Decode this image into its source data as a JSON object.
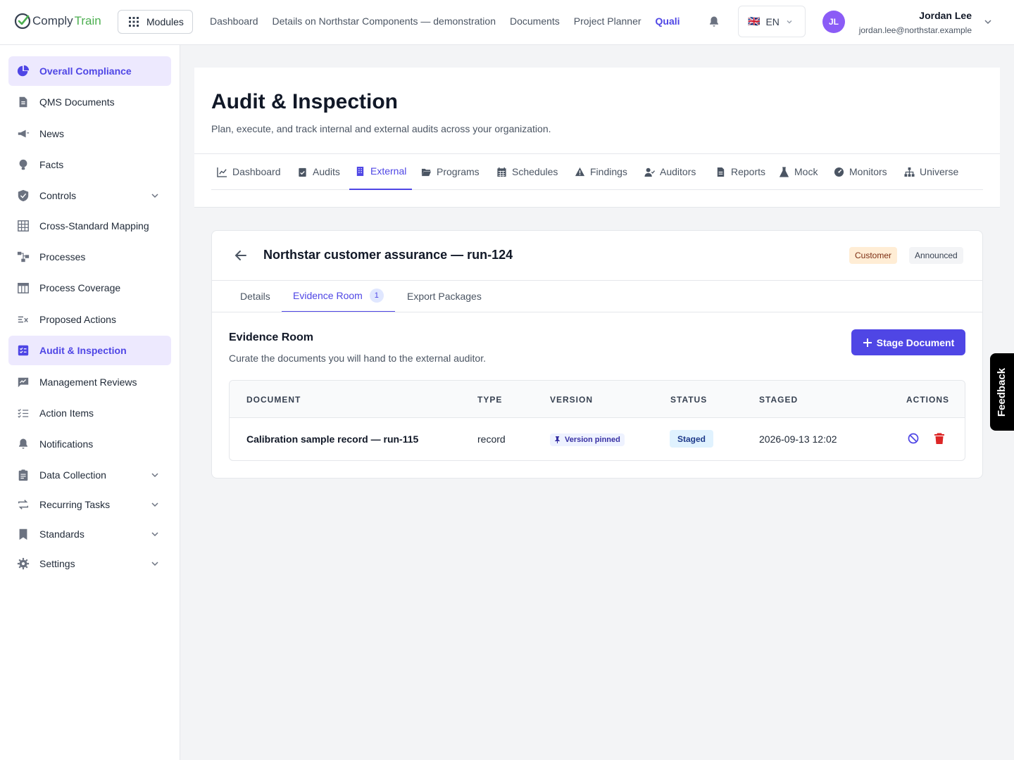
{
  "app": {
    "logo_part1": "Comply",
    "logo_part2": "Train",
    "modules_label": "Modules"
  },
  "topnav": [
    "Dashboard",
    "Details on Northstar Components — demonstration",
    "Documents",
    "Project Planner",
    "Quali"
  ],
  "lang": {
    "flag": "🇬🇧",
    "code": "EN"
  },
  "user": {
    "initials": "JL",
    "name": "Jordan Lee",
    "email": "jordan.lee@northstar.example"
  },
  "sidebar": {
    "items": [
      {
        "label": "Overall Compliance",
        "icon": "pie-chart-icon"
      },
      {
        "label": "QMS Documents",
        "icon": "document-icon"
      },
      {
        "label": "News",
        "icon": "megaphone-icon"
      },
      {
        "label": "Facts",
        "icon": "lightbulb-icon"
      },
      {
        "label": "Controls",
        "icon": "shield-icon"
      },
      {
        "label": "Cross-Standard Mapping",
        "icon": "grid-icon"
      },
      {
        "label": "Processes",
        "icon": "flow-icon"
      },
      {
        "label": "Process Coverage",
        "icon": "table-icon"
      },
      {
        "label": "Proposed Actions",
        "icon": "list-x-icon"
      },
      {
        "label": "Audit & Inspection",
        "icon": "checklist-icon"
      },
      {
        "label": "Management Reviews",
        "icon": "chart-review-icon"
      },
      {
        "label": "Action Items",
        "icon": "list-check-icon"
      },
      {
        "label": "Notifications",
        "icon": "bell-icon"
      },
      {
        "label": "Data Collection",
        "icon": "clipboard-icon"
      },
      {
        "label": "Recurring Tasks",
        "icon": "repeat-icon"
      },
      {
        "label": "Standards",
        "icon": "bookmark-icon"
      },
      {
        "label": "Settings",
        "icon": "gear-icon"
      }
    ]
  },
  "page": {
    "title": "Audit & Inspection",
    "subtitle": "Plan, execute, and track internal and external audits across your organization.",
    "tabs": [
      "Dashboard",
      "Audits",
      "External",
      "Programs",
      "Schedules",
      "Findings",
      "Auditors",
      "Reports",
      "Mock",
      "Monitors",
      "Universe"
    ]
  },
  "detail": {
    "title": "Northstar customer assurance — run-124",
    "badge_type": "Customer",
    "badge_state": "Announced",
    "subtabs": {
      "details": "Details",
      "evidence": "Evidence Room",
      "evidence_count": "1",
      "export": "Export Packages"
    },
    "evidence": {
      "title": "Evidence Room",
      "subtitle": "Curate the documents you will hand to the external auditor.",
      "stage_button": "Stage Document",
      "columns": [
        "DOCUMENT",
        "TYPE",
        "VERSION",
        "STATUS",
        "STAGED",
        "ACTIONS"
      ],
      "rows": [
        {
          "document": "Calibration sample record — run-115",
          "type": "record",
          "version": "Version pinned",
          "status": "Staged",
          "staged": "2026-09-13 12:02"
        }
      ]
    }
  },
  "feedback_label": "Feedback",
  "colors": {
    "accent": "#4f46e5",
    "danger": "#dc2626",
    "customer_badge": "#ffedd5"
  }
}
